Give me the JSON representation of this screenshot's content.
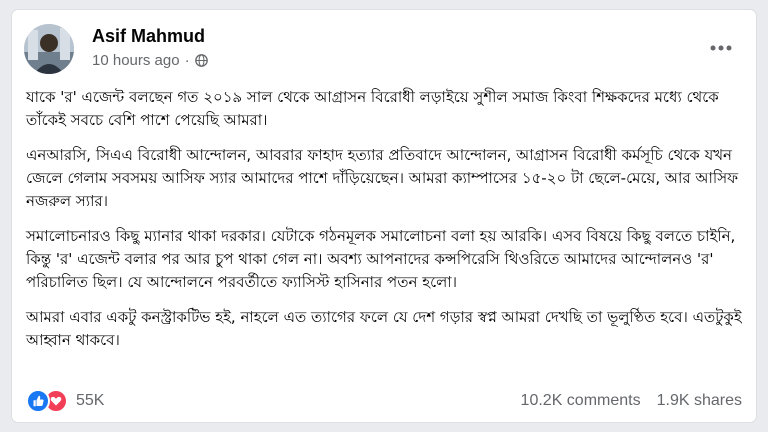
{
  "post": {
    "author": "Asif Mahmud",
    "timestamp": "10 hours ago",
    "privacy_icon": "globe-icon",
    "paragraphs": [
      "যাকে 'র' এজেন্ট বলছেন গত ২০১৯ সাল থেকে আগ্রাসন বিরোধী লড়াইয়ে সুশীল সমাজ কিংবা শিক্ষকদের মধ্যে থেকে তাঁকেই সবচে বেশি পাশে পেয়েছি আমরা।",
      "এনআরসি, সিএএ বিরোধী আন্দোলন, আবরার ফাহাদ হত্যার প্রতিবাদে আন্দোলন, আগ্রাসন বিরোধী কর্মসূচি থেকে যখন জেলে গেলাম সবসময় আসিফ স্যার আমাদের পাশে দাঁড়িয়েছেন। আমরা ক্যাম্পাসের ১৫-২০ টা ছেলে-মেয়ে, আর আসিফ নজরুল স্যার।",
      "সমালোচনারও কিছু ম্যানার থাকা দরকার। যেটাকে গঠনমূলক সমালোচনা বলা হয় আরকি। এসব বিষয়ে কিছু বলতে চাইনি, কিন্তু 'র' এজেন্ট বলার পর আর চুপ থাকা গেল না। অবশ্য আপনাদের কন্সপিরেসি থিওরিতে আমাদের আন্দোলনও 'র' পরিচালিত ছিল। যে আন্দোলনে পরবর্তীতে ফ্যাসিস্ট হাসিনার পতন হলো।",
      "আমরা এবার একটু কনস্ট্রাকটিভ হই, নাহলে এত ত্যাগের ফলে যে দেশ গড়ার স্বপ্ন আমরা দেখছি তা ভূলুণ্ঠিত হবে। এতটুকুই আহ্বান থাকবে।"
    ],
    "reactions": {
      "icons": [
        "like-icon",
        "love-icon"
      ],
      "count": "55K"
    },
    "comments": "10.2K comments",
    "shares": "1.9K shares"
  },
  "colors": {
    "like": "#1877f2",
    "love": "#f33e58",
    "secondary_text": "#65676b"
  }
}
